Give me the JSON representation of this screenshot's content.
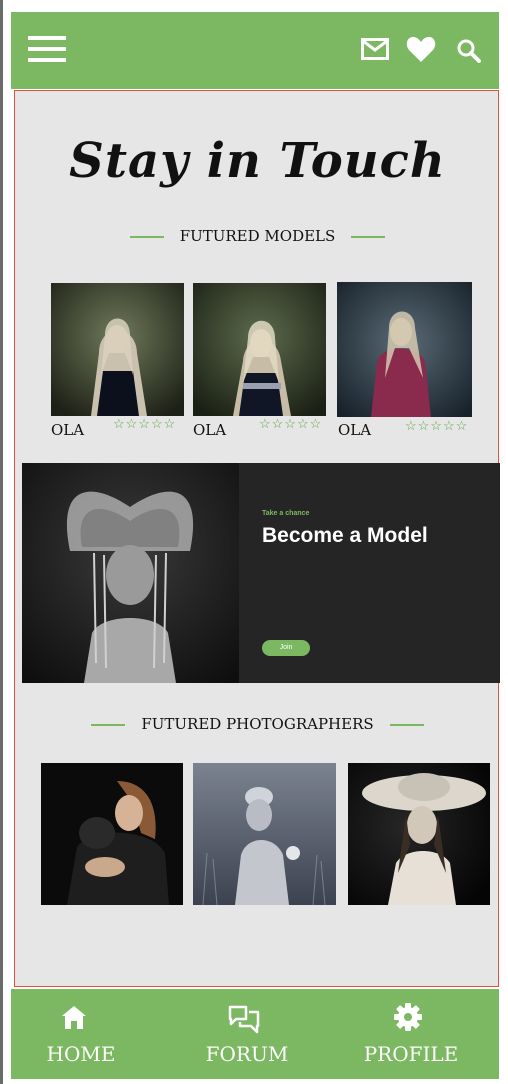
{
  "header": {
    "menu_icon": "hamburger-icon",
    "icons": [
      "mail-icon",
      "heart-icon",
      "search-icon"
    ],
    "background": "#7cb862"
  },
  "main": {
    "title": "Stay in Touch",
    "featured_models": {
      "heading": "FUTURED MODELS",
      "items": [
        {
          "name": "OLA",
          "stars": "☆☆☆☆☆",
          "rating": 5
        },
        {
          "name": "OLA",
          "stars": "☆☆☆☆☆",
          "rating": 5
        },
        {
          "name": "OLA",
          "stars": "☆☆☆☆☆",
          "rating": 5
        }
      ]
    },
    "banner": {
      "kicker": "Take a chance",
      "title": "Become a Model",
      "button_label": "Join"
    },
    "featured_photographers": {
      "heading": "FUTURED PHOTOGRAPHERS"
    }
  },
  "bottom_nav": {
    "items": [
      {
        "label": "HOME",
        "icon": "home-icon"
      },
      {
        "label": "FORUM",
        "icon": "forum-icon"
      },
      {
        "label": "PROFILE",
        "icon": "gear-icon"
      }
    ]
  },
  "colors": {
    "accent": "#7cb862",
    "banner_bg": "#252525",
    "content_bg": "#e6e6e6",
    "frame": "#e0503c"
  }
}
